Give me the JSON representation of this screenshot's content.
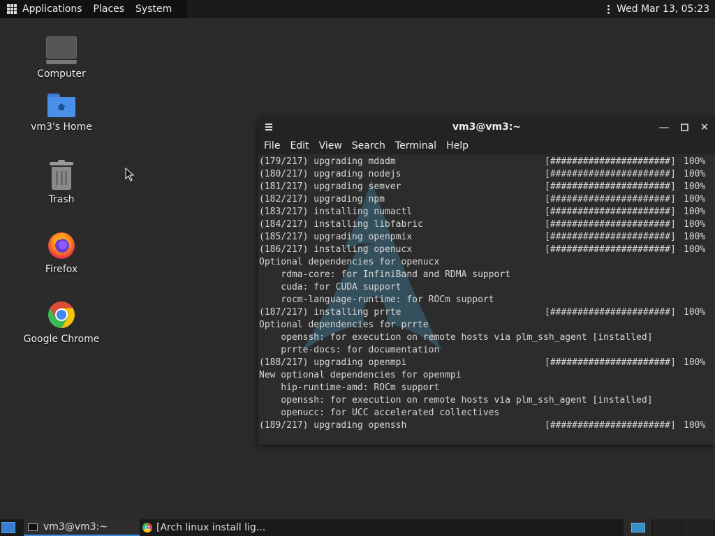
{
  "top_panel": {
    "menus": [
      "Applications",
      "Places",
      "System"
    ],
    "clock": "Wed Mar 13, 05:23"
  },
  "desktop_icons": [
    {
      "label": "Computer",
      "icon": "computer-icon"
    },
    {
      "label": "vm3's Home",
      "icon": "home-folder-icon"
    },
    {
      "label": "Trash",
      "icon": "trash-icon"
    },
    {
      "label": "Firefox",
      "icon": "firefox-icon"
    },
    {
      "label": "Google Chrome",
      "icon": "chrome-icon"
    }
  ],
  "terminal": {
    "title": "vm3@vm3:~",
    "menu": [
      "File",
      "Edit",
      "View",
      "Search",
      "Terminal",
      "Help"
    ],
    "lines": [
      {
        "text": "(179/217) upgrading mdadm",
        "bar": "[######################]",
        "pct": "100%"
      },
      {
        "text": "(180/217) upgrading nodejs",
        "bar": "[######################]",
        "pct": "100%"
      },
      {
        "text": "(181/217) upgrading semver",
        "bar": "[######################]",
        "pct": "100%"
      },
      {
        "text": "(182/217) upgrading npm",
        "bar": "[######################]",
        "pct": "100%"
      },
      {
        "text": "(183/217) installing numactl",
        "bar": "[######################]",
        "pct": "100%"
      },
      {
        "text": "(184/217) installing libfabric",
        "bar": "[######################]",
        "pct": "100%"
      },
      {
        "text": "(185/217) upgrading openpmix",
        "bar": "[######################]",
        "pct": "100%"
      },
      {
        "text": "(186/217) installing openucx",
        "bar": "[######################]",
        "pct": "100%"
      },
      {
        "text": "Optional dependencies for openucx",
        "bar": "",
        "pct": ""
      },
      {
        "text": "    rdma-core: for InfiniBand and RDMA support",
        "bar": "",
        "pct": ""
      },
      {
        "text": "    cuda: for CUDA support",
        "bar": "",
        "pct": ""
      },
      {
        "text": "    rocm-language-runtime: for ROCm support",
        "bar": "",
        "pct": ""
      },
      {
        "text": "(187/217) installing prrte",
        "bar": "[######################]",
        "pct": "100%"
      },
      {
        "text": "Optional dependencies for prrte",
        "bar": "",
        "pct": ""
      },
      {
        "text": "    openssh: for execution on remote hosts via plm_ssh_agent [installed]",
        "bar": "",
        "pct": ""
      },
      {
        "text": "    prrte-docs: for documentation",
        "bar": "",
        "pct": ""
      },
      {
        "text": "(188/217) upgrading openmpi",
        "bar": "[######################]",
        "pct": "100%"
      },
      {
        "text": "New optional dependencies for openmpi",
        "bar": "",
        "pct": ""
      },
      {
        "text": "    hip-runtime-amd: ROCm support",
        "bar": "",
        "pct": ""
      },
      {
        "text": "    openssh: for execution on remote hosts via plm_ssh_agent [installed]",
        "bar": "",
        "pct": ""
      },
      {
        "text": "    openucc: for UCC accelerated collectives",
        "bar": "",
        "pct": ""
      },
      {
        "text": "(189/217) upgrading openssh",
        "bar": "[######################]",
        "pct": "100%"
      }
    ]
  },
  "taskbar": {
    "tasks": [
      {
        "label": "vm3@vm3:~",
        "active": true
      },
      {
        "label": "[Arch linux install lig...",
        "active": false
      }
    ]
  },
  "colors": {
    "desktop_bg": "#2b2b2b",
    "panel_bg": "#1b1b1b",
    "accent": "#3b8ee0"
  }
}
